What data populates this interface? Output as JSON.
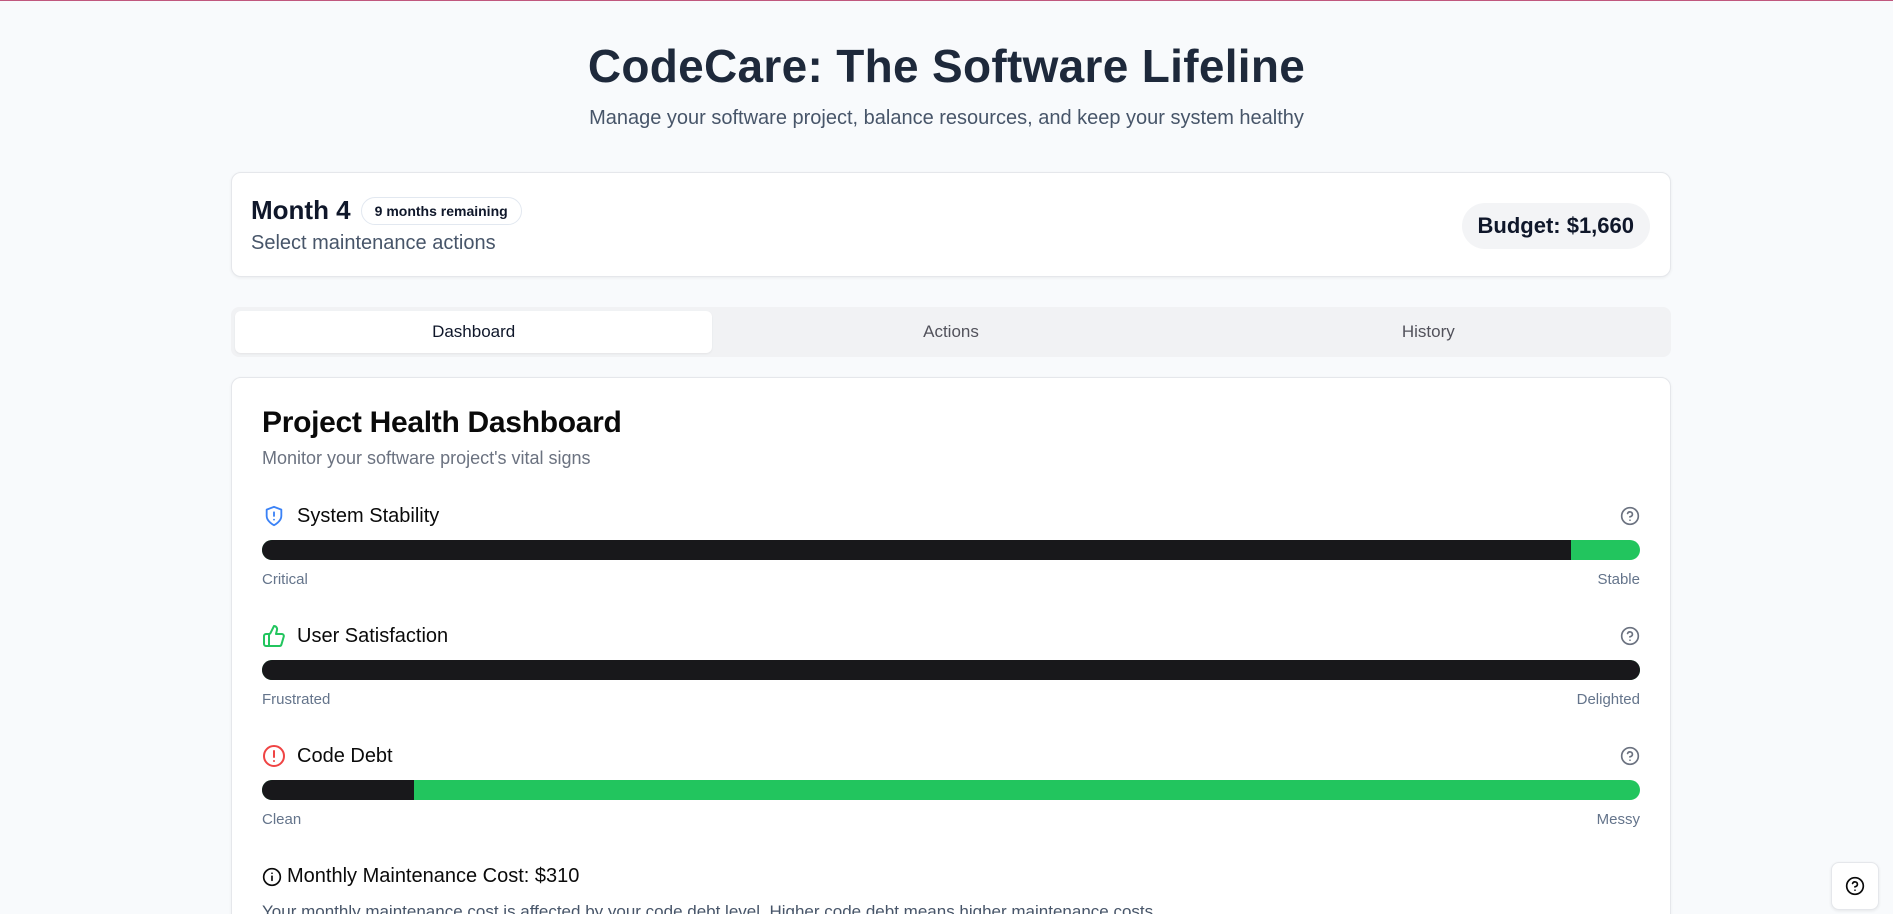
{
  "app": {
    "title": "CodeCare: The Software Lifeline",
    "subtitle": "Manage your software project, balance resources, and keep your system healthy"
  },
  "status": {
    "month_label": "Month 4",
    "months_remaining": "9 months remaining",
    "instruction": "Select maintenance actions",
    "budget": "Budget: $1,660"
  },
  "tabs": [
    {
      "label": "Dashboard",
      "active": true
    },
    {
      "label": "Actions",
      "active": false
    },
    {
      "label": "History",
      "active": false
    }
  ],
  "dashboard": {
    "title": "Project Health Dashboard",
    "subtitle": "Monitor your software project's vital signs",
    "metrics": [
      {
        "name": "System Stability",
        "icon": "shield-alert-icon",
        "icon_color": "#3b82f6",
        "level": 0.95,
        "low_label": "Critical",
        "high_label": "Stable"
      },
      {
        "name": "User Satisfaction",
        "icon": "thumbs-up-icon",
        "icon_color": "#22c55e",
        "level": 1.0,
        "low_label": "Frustrated",
        "high_label": "Delighted"
      },
      {
        "name": "Code Debt",
        "icon": "alert-circle-icon",
        "icon_color": "#ef4444",
        "level": 0.11,
        "low_label": "Clean",
        "high_label": "Messy"
      }
    ],
    "maintenance_cost": "Monthly Maintenance Cost: $310",
    "maintenance_note": "Your monthly maintenance cost is affected by your code debt level. Higher code debt means higher maintenance costs."
  },
  "colors": {
    "bar_fill": "#18181b",
    "bar_track": "#22c55e",
    "accent_border": "#c0587e"
  }
}
